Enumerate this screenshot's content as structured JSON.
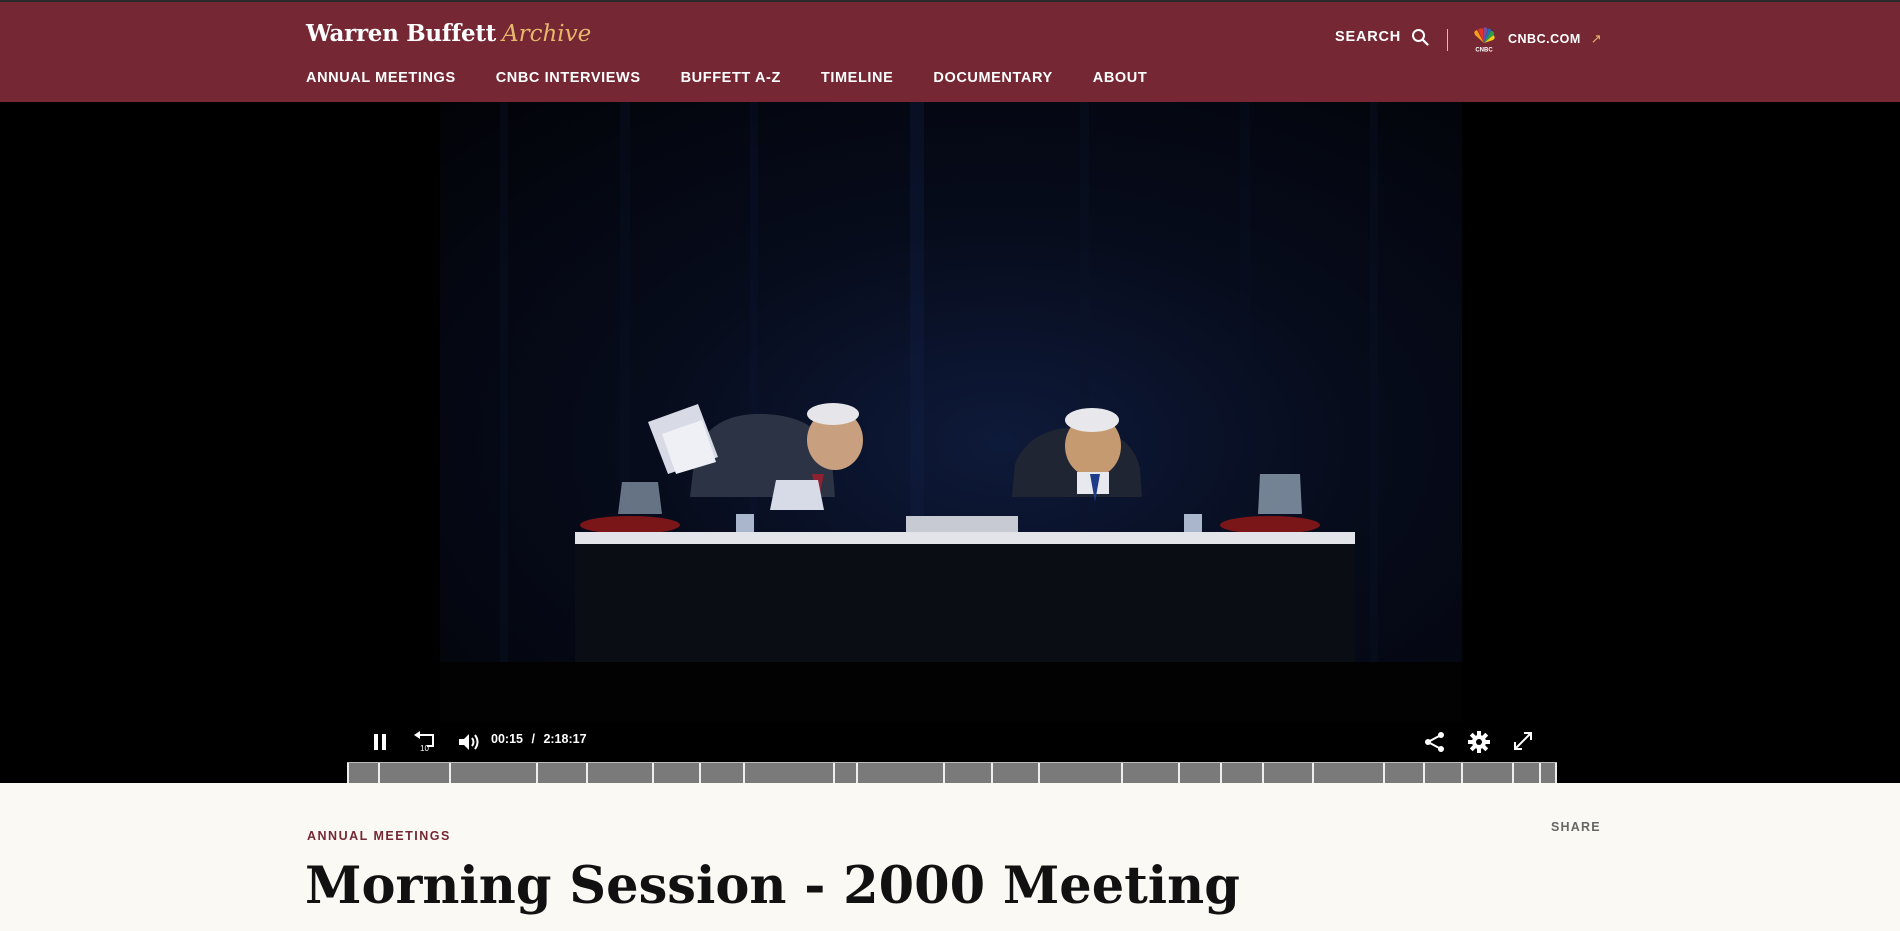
{
  "header": {
    "brand_main": "Warren Buffett",
    "brand_accent": "Archive",
    "search_label": "SEARCH",
    "cnbc_label": "CNBC.COM",
    "nav": [
      {
        "label": "ANNUAL MEETINGS"
      },
      {
        "label": "CNBC INTERVIEWS"
      },
      {
        "label": "BUFFETT A-Z"
      },
      {
        "label": "TIMELINE"
      },
      {
        "label": "DOCUMENTARY"
      },
      {
        "label": "ABOUT"
      }
    ]
  },
  "player": {
    "current_time": "00:15",
    "separator": "/",
    "duration": "2:18:17",
    "skip_back_label": "10",
    "chapter_markers_count": 24
  },
  "content": {
    "eyebrow": "ANNUAL MEETINGS",
    "share_label": "SHARE",
    "title": "Morning Session - 2000 Meeting"
  },
  "colors": {
    "brand_red": "#752834",
    "accent_gold": "#e7b86c",
    "page_bg": "#fbf9f4"
  }
}
